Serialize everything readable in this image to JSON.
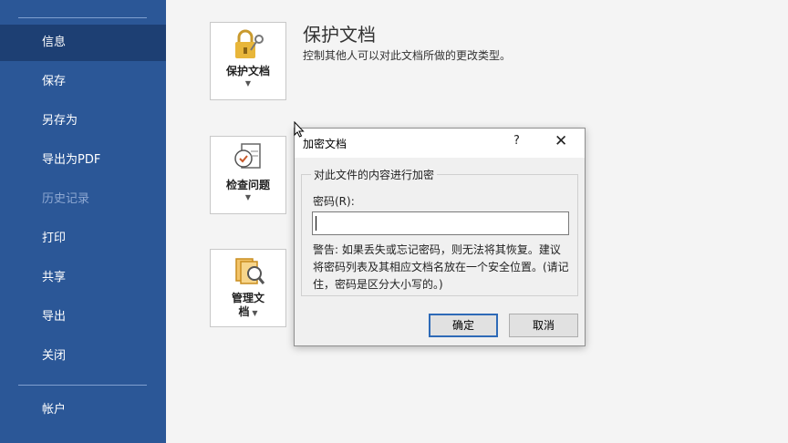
{
  "sidebar": {
    "items": [
      {
        "label": "信息"
      },
      {
        "label": "保存"
      },
      {
        "label": "另存为"
      },
      {
        "label": "导出为PDF"
      },
      {
        "label": "历史记录"
      },
      {
        "label": "打印"
      },
      {
        "label": "共享"
      },
      {
        "label": "导出"
      },
      {
        "label": "关闭"
      },
      {
        "label": "帐户"
      }
    ]
  },
  "main": {
    "protect": {
      "label": "保护文档",
      "title": "保护文档",
      "desc": "控制其他人可以对此文档所做的更改类型。"
    },
    "inspect": {
      "label": "检查问题"
    },
    "manage": {
      "label_line1": "管理文",
      "label_line2": "档"
    }
  },
  "dialog": {
    "title": "加密文档",
    "help": "?",
    "close": "✕",
    "group_label": "对此文件的内容进行加密",
    "password_label": "密码(R):",
    "password_value": "",
    "warning": "警告: 如果丢失或忘记密码，则无法将其恢复。建议将密码列表及其相应文档名放在一个安全位置。(请记住，密码是区分大小写的。)",
    "ok_label": "确定",
    "cancel_label": "取消"
  },
  "colors": {
    "sidebar_bg": "#2b5797",
    "sidebar_active": "#1d3f73",
    "accent": "#2e6ab7"
  }
}
